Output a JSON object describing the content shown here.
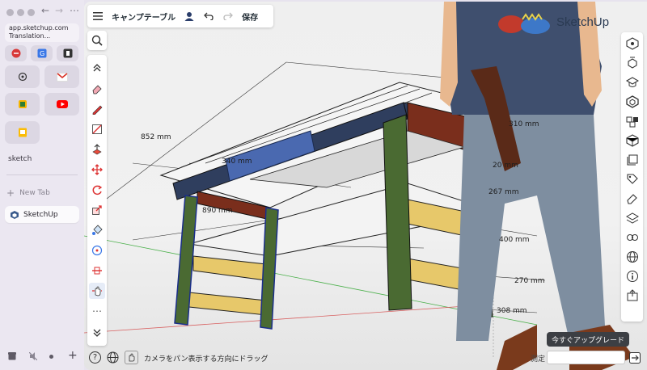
{
  "browser": {
    "url_line1": "app.sketchup.com",
    "url_line2": "Translation...",
    "section_label": "sketch",
    "new_tab_label": "New Tab",
    "active_tab_label": "SketchUp"
  },
  "topbar": {
    "model_title": "キャンプテーブル",
    "save_label": "保存"
  },
  "logo": {
    "text": "SketchUp"
  },
  "dimensions": [
    "852 mm",
    "340 mm",
    "890 mm",
    "310 mm",
    "267 mm",
    "400 mm",
    "270 mm",
    "308 mm",
    "20 mm"
  ],
  "status": {
    "hint": "カメラをパン表示する方向にドラッグ",
    "measure_label": "測定",
    "measure_value": ""
  },
  "upgrade_label": "今すぐアップグレード",
  "colors": {
    "table_top": "#f3f3f3",
    "frame_navy": "#2f3e5e",
    "legs_green": "#4a6a32",
    "shelf_yellow": "#e7c86a",
    "rail_brown": "#7a2e1c",
    "accent_blue": "#4a69b0"
  }
}
